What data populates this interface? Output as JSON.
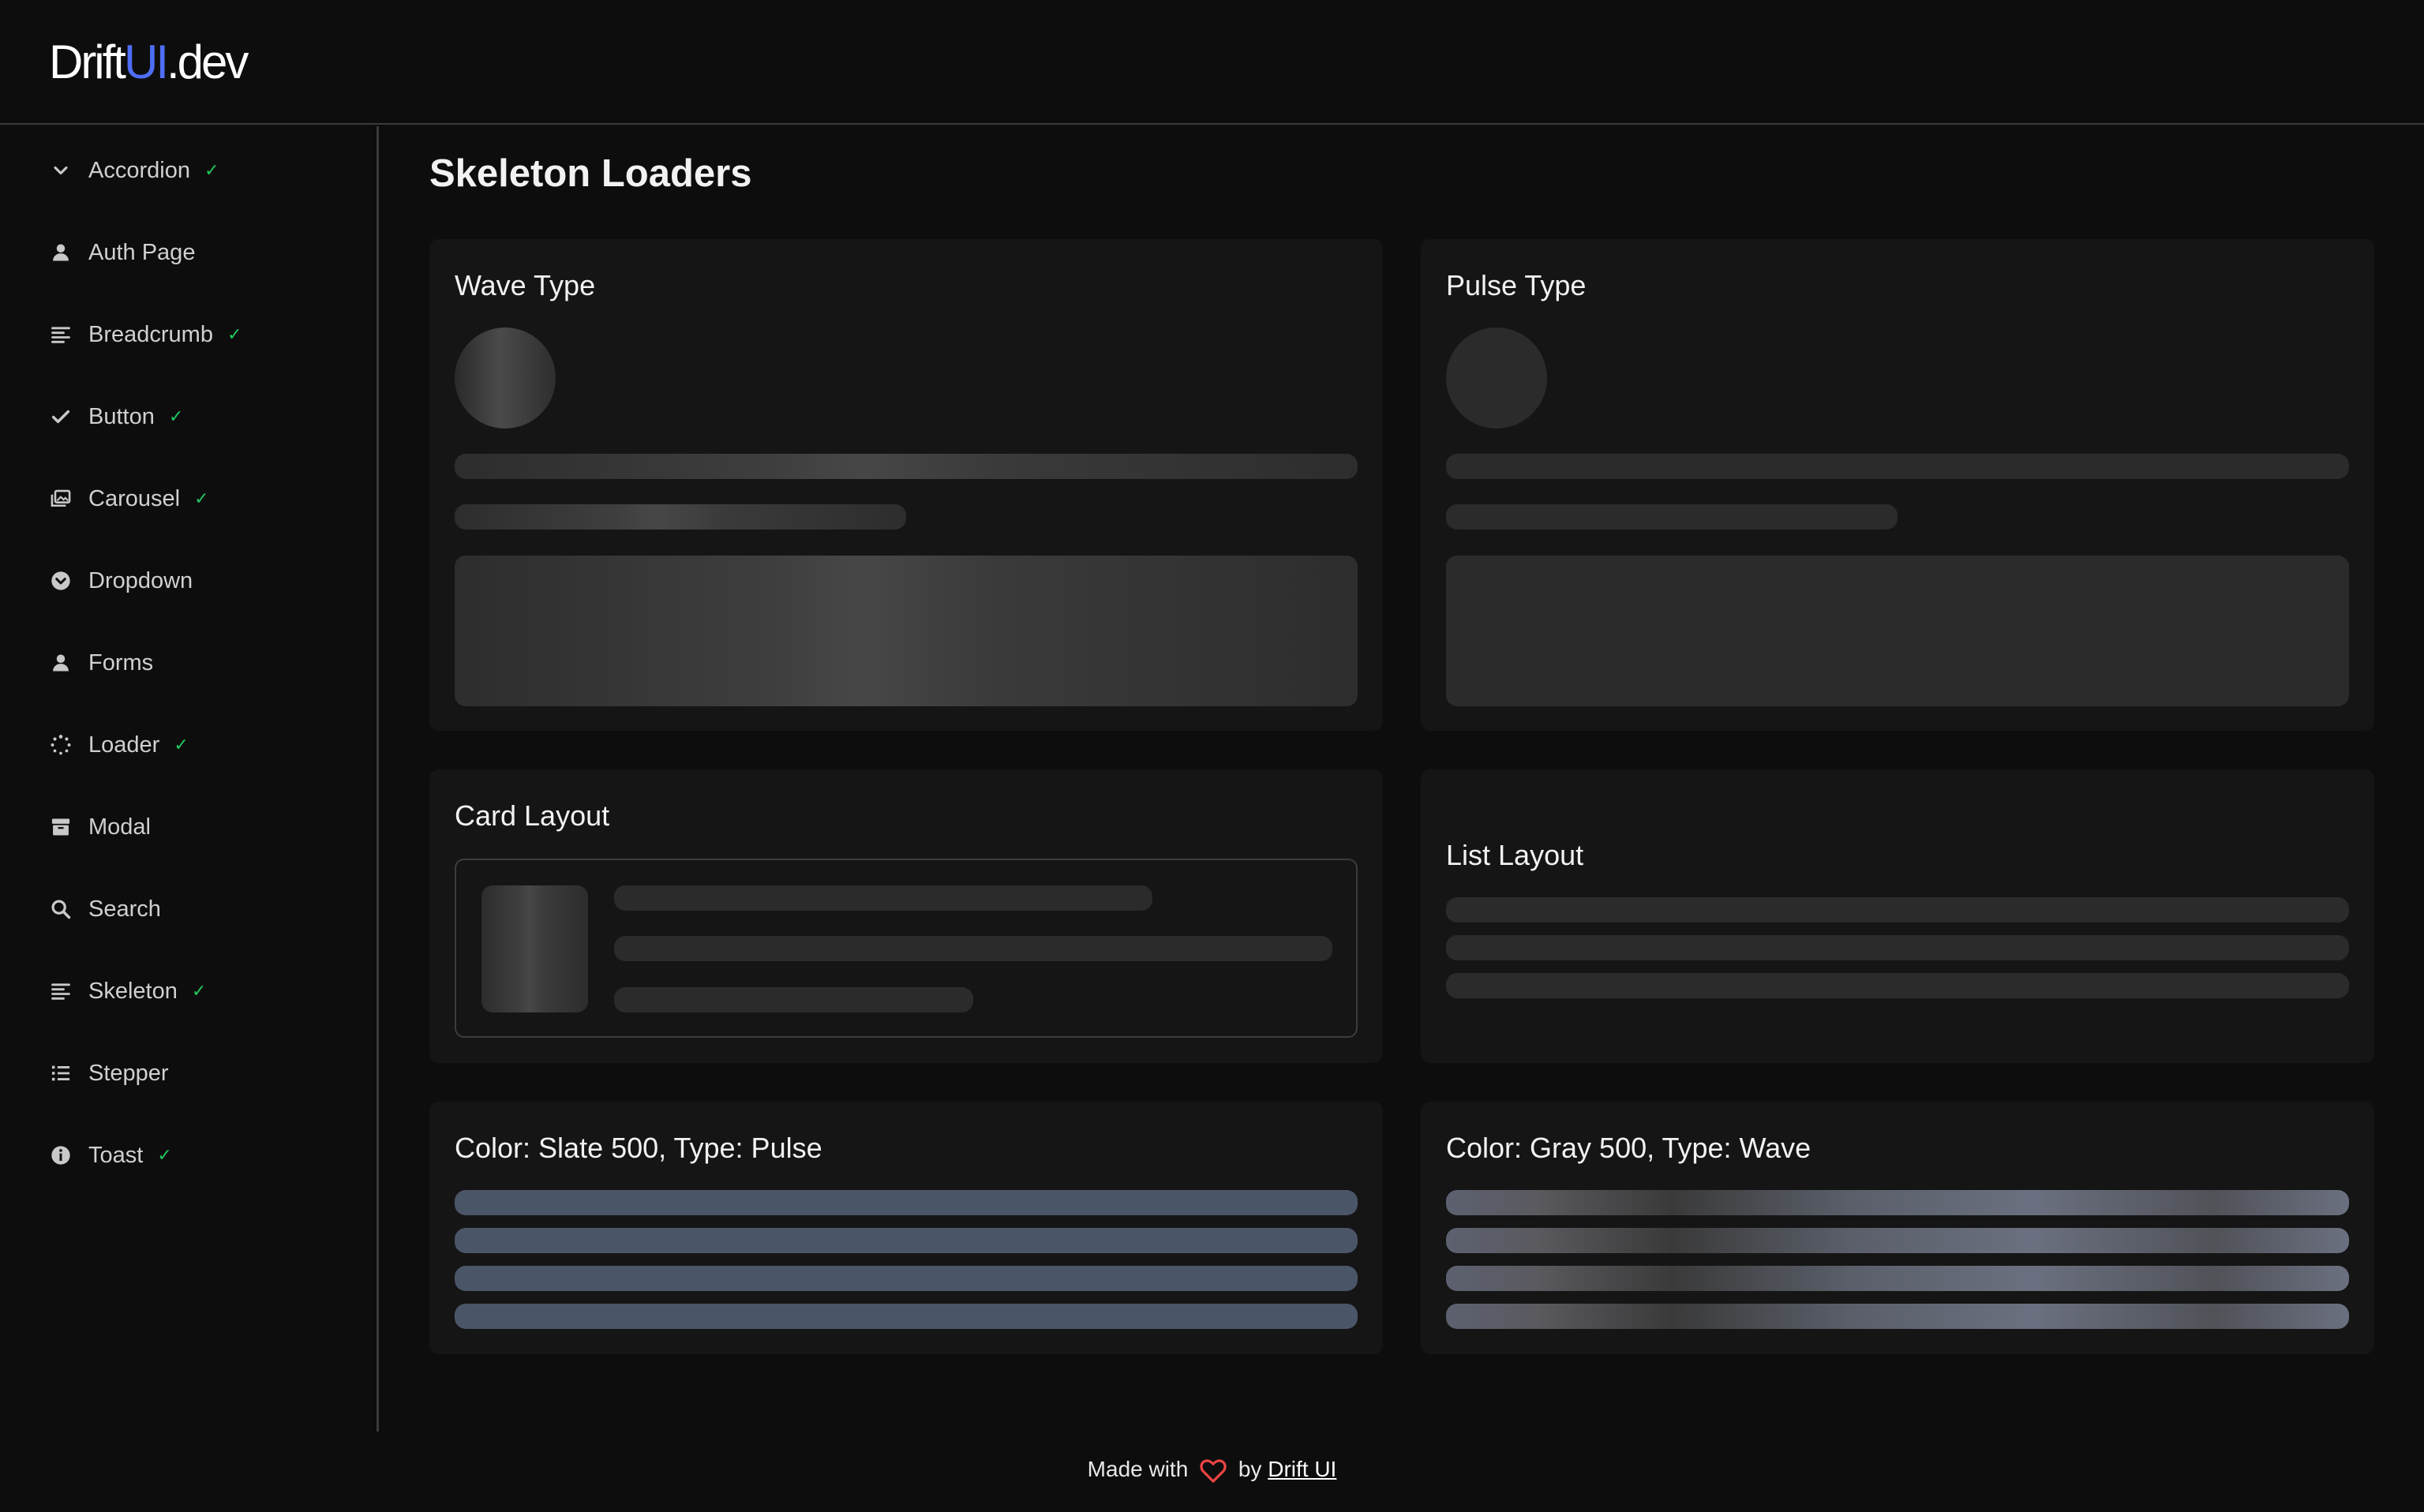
{
  "logo": {
    "part1": "Drift",
    "part2": "UI",
    "part3": ".dev"
  },
  "page_title": "Skeleton Loaders",
  "sidebar": {
    "items": [
      {
        "label": "Accordion",
        "icon": "chevron-down-icon",
        "done": true
      },
      {
        "label": "Auth Page",
        "icon": "user-icon",
        "done": false
      },
      {
        "label": "Breadcrumb",
        "icon": "align-left-icon",
        "done": true
      },
      {
        "label": "Button",
        "icon": "check-icon",
        "done": true
      },
      {
        "label": "Carousel",
        "icon": "images-icon",
        "done": true
      },
      {
        "label": "Dropdown",
        "icon": "circle-chevron-icon",
        "done": false
      },
      {
        "label": "Forms",
        "icon": "user-icon",
        "done": false
      },
      {
        "label": "Loader",
        "icon": "spinner-icon",
        "done": true
      },
      {
        "label": "Modal",
        "icon": "box-icon",
        "done": false
      },
      {
        "label": "Search",
        "icon": "search-icon",
        "done": false
      },
      {
        "label": "Skeleton",
        "icon": "align-left-icon",
        "done": true
      },
      {
        "label": "Stepper",
        "icon": "list-icon",
        "done": false
      },
      {
        "label": "Toast",
        "icon": "info-icon",
        "done": true
      }
    ],
    "check_mark": "✓"
  },
  "cards": {
    "wave": {
      "title": "Wave Type"
    },
    "pulse": {
      "title": "Pulse Type"
    },
    "card_layout": {
      "title": "Card Layout"
    },
    "list_layout": {
      "title": "List Layout"
    },
    "slate": {
      "title": "Color: Slate 500, Type: Pulse"
    },
    "gray": {
      "title": "Color: Gray 500, Type: Wave"
    }
  },
  "footer": {
    "made_with": "Made with",
    "by": "by",
    "link": "Drift UI"
  },
  "colors": {
    "accent": "#4f6ef7",
    "check": "#22c55e",
    "heart": "#ef4444",
    "slate": "#4b5568"
  }
}
